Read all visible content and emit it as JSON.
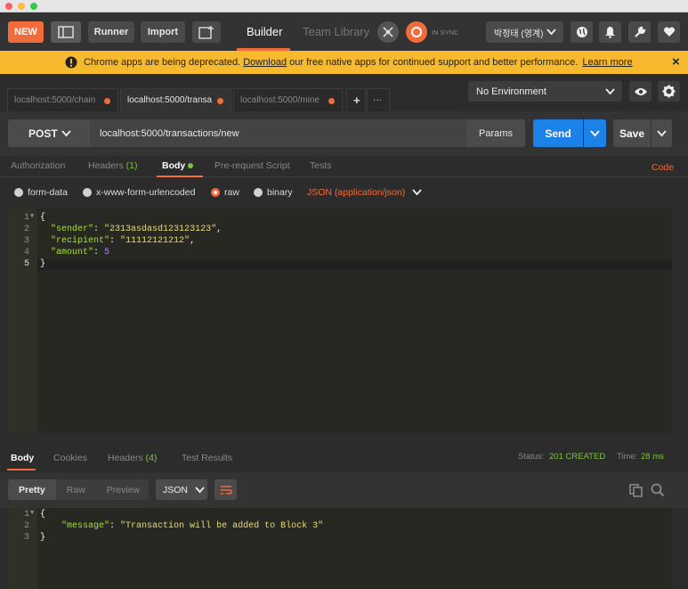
{
  "toolbar": {
    "new_label": "NEW",
    "runner_label": "Runner",
    "import_label": "Import",
    "builder_tab": "Builder",
    "team_library_tab": "Team Library",
    "sync_status": "IN SYNC",
    "user_name": "박정태 (영계)",
    "accent_color": "#f26b3a"
  },
  "banner": {
    "text_before": "Chrome apps are being deprecated.",
    "download_link": "Download",
    "text_after": "our free native apps for continued support and better performance.",
    "learn_more_link": "Learn more",
    "close_icon": "×"
  },
  "tabs": [
    {
      "label": "localhost:5000/chain"
    },
    {
      "label": "localhost:5000/transa"
    },
    {
      "label": "localhost:5000/mine"
    }
  ],
  "tab_actions": {
    "add": "+",
    "more": "···"
  },
  "environment": {
    "selected": "No Environment"
  },
  "request": {
    "method": "POST",
    "url": "localhost:5000/transactions/new",
    "params_label": "Params",
    "send_label": "Send",
    "save_label": "Save"
  },
  "request_tabs": {
    "authorization": "Authorization",
    "headers": "Headers",
    "headers_count": "(1)",
    "body": "Body",
    "pre_request": "Pre-request Script",
    "tests": "Tests",
    "code": "Code"
  },
  "body_options": {
    "form_data": "form-data",
    "urlencoded": "x-www-form-urlencoded",
    "raw": "raw",
    "binary": "binary",
    "content_type": "JSON (application/json)"
  },
  "request_body": {
    "line_numbers": [
      "1",
      "2",
      "3",
      "4",
      "5"
    ],
    "open_brace": "{",
    "close_brace": "}",
    "sender_key": "\"sender\"",
    "sender_value": "\"2313asdasd123123123\"",
    "recipient_key": "\"recipient\"",
    "recipient_value": "\"11112121212\"",
    "amount_key": "\"amount\"",
    "amount_value": "5"
  },
  "response": {
    "tabs": {
      "body": "Body",
      "cookies": "Cookies",
      "headers": "Headers",
      "headers_count": "(4)",
      "test_results": "Test Results"
    },
    "status_label": "Status:",
    "status_value": "201 CREATED",
    "time_label": "Time:",
    "time_value": "28 ms",
    "view_modes": {
      "pretty": "Pretty",
      "raw": "Raw",
      "preview": "Preview"
    },
    "format": "JSON",
    "line_numbers": [
      "1",
      "2",
      "3"
    ],
    "open_brace": "{",
    "close_brace": "}",
    "message_key": "\"message\"",
    "message_value": "\"Transaction will be added to Block 3\""
  }
}
